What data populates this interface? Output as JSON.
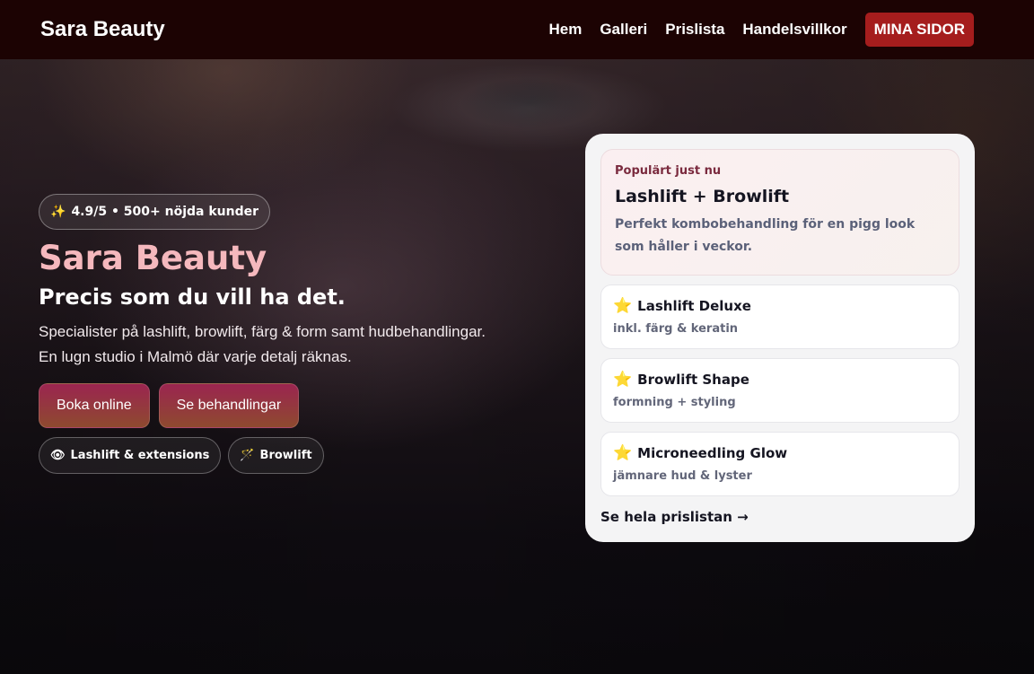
{
  "nav": {
    "brand": "Sara Beauty",
    "links": [
      "Hem",
      "Galleri",
      "Prislista",
      "Handelsvillkor"
    ],
    "cta": "MINA SIDOR"
  },
  "hero": {
    "rating_icon": "✨",
    "rating": "4.9/5 • 500+ nöjda kunder",
    "title": "Sara Beauty",
    "subtitle": "Precis som du vill ha det.",
    "desc_line1": "Specialister på lashlift, browlift, färg & form samt hudbehandlingar.",
    "desc_line2": "En lugn studio i Malmö där varje detalj räknas.",
    "buttons": [
      "Boka online",
      "Se behandlingar"
    ],
    "tags": [
      {
        "icon": "👁",
        "label": "Lashlift & extensions"
      },
      {
        "icon": "🪄",
        "label": "Browlift"
      }
    ]
  },
  "card": {
    "featured": {
      "kicker": "Populärt just nu",
      "title": "Lashlift + Browlift",
      "desc": "Perfekt kombobehandling för en pigg look som håller i veckor."
    },
    "treatments": [
      {
        "icon": "⭐",
        "name": "Lashlift Deluxe",
        "sub": "inkl. färg & keratin"
      },
      {
        "icon": "⭐",
        "name": "Browlift Shape",
        "sub": "formning + styling"
      },
      {
        "icon": "⭐",
        "name": "Microneedling Glow",
        "sub": "jämnare hud & lyster"
      }
    ],
    "link": "Se hela prislistan →"
  },
  "colors": {
    "nav_bg": "#1c0303",
    "cta_bg": "#a51d1d",
    "title_pink": "#f5b8bd",
    "button_gradient_top": "#9b2550",
    "button_gradient_bottom": "#8e4a2f"
  }
}
